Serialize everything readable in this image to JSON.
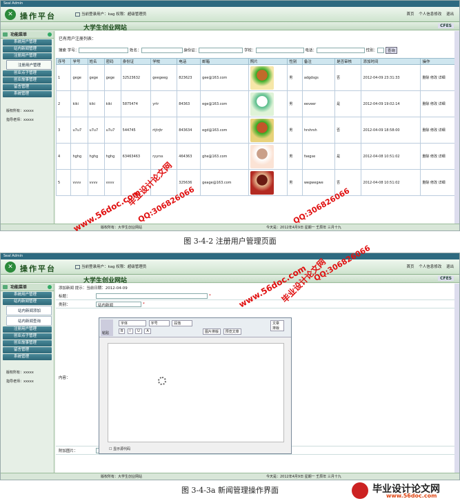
{
  "s1": {
    "window_title": "Seal Admin",
    "brand": "操作平台",
    "user_bar": "当前登录用户：kag 权限：超级管理员",
    "links": [
      "首页",
      "个人信息修改",
      "退出"
    ],
    "site_title": "大学生创业网站",
    "cfes": "CFES",
    "menu_header": "功能菜单",
    "menu": [
      "系统用户管理",
      "站内新闻管理",
      "注册用户管理",
      "注册用户管理",
      "创业点子管理",
      "创业故事管理",
      "留言管理",
      "系统管理"
    ],
    "info1": "版权所有：xxxxx",
    "info2": "指导老师：xxxxx",
    "list_title": "已有用户注册列表：",
    "search": {
      "label": "搜索",
      "fields": [
        "学号：",
        "姓名：",
        "身份证：",
        "学校：",
        "电话：",
        "性别："
      ],
      "button": "查询"
    },
    "columns": [
      "序号",
      "学号",
      "姓名",
      "密码",
      "身份证",
      "学校",
      "电话",
      "邮箱",
      "照片",
      "性别",
      "备注",
      "是否审核",
      "添加时间",
      "操作"
    ],
    "rows": [
      [
        "1",
        "gege",
        "gege",
        "gege",
        "32523632",
        "geegeeg",
        "823623",
        "gee@163.com",
        "",
        "男",
        "adgdsgs",
        "否",
        "2012-04-09 23:31:33",
        "删除 修改 详细"
      ],
      [
        "2",
        "kiki",
        "kiki",
        "kiki",
        "5875474",
        "yrtr",
        "84363",
        "ege@163.com",
        "",
        "男",
        "eeveer",
        "是",
        "2012-04-09 19:02:14",
        "删除 修改 详细"
      ],
      [
        "3",
        "u7u7",
        "u7u7",
        "u7u7",
        "544745",
        "rtjtrjtr",
        "843634",
        "egd@163.com",
        "",
        "男",
        "hrshrsh",
        "否",
        "2012-04-09 18:58:00",
        "删除 修改 详细"
      ],
      [
        "4",
        "hghg",
        "hghg",
        "hghg",
        "63463463",
        "ryyrss",
        "464363",
        "ghe@163.com",
        "",
        "男",
        "fsegse",
        "是",
        "2012-04-08 10:51:02",
        "删除 修改 详细"
      ],
      [
        "5",
        "vvvv",
        "vvvv",
        "vvvv",
        "",
        "",
        "325636",
        "geage@163.com",
        "",
        "男",
        "wegwegwe",
        "否",
        "2012-04-08 10:51:02",
        "删除 修改 详细"
      ]
    ],
    "status_left": "版权所有：大学生创业网站",
    "status_right": "今天是：2012年4月9日 星期一 壬辰年 三月十九"
  },
  "caption1": "图 3-4-2 注册用户管理页面",
  "s2": {
    "window_title": "Seal Admin",
    "brand": "操作平台",
    "user_bar": "当前登录用户：kag 权限：超级管理员",
    "links": [
      "首页",
      "个人信息修改",
      "退出"
    ],
    "site_title": "大学生创业网站",
    "cfes": "CFES",
    "menu_header": "功能菜单",
    "menu": [
      "系统用户管理",
      "站内新闻管理",
      "站内新闻添加",
      "站内新闻查询",
      "注册用户管理",
      "创业点子管理",
      "创业故事管理",
      "留言管理",
      "系统管理"
    ],
    "info1": "版权所有：xxxxx",
    "info2": "指导老师：xxxxx",
    "top_line": "添加新闻 提示：当前日期：2012-04-09",
    "label_title": "标题：",
    "label_cat": "类别：",
    "cat_value": "站内新闻",
    "label_content": "内容：",
    "label_extra": "附加图片：",
    "editor_row1": [
      "字体",
      "字号",
      "段落"
    ],
    "editor_row2": [
      "B",
      "I",
      "U",
      "A"
    ],
    "editor_btns": [
      "图片排版",
      "预览文章",
      "文章排版"
    ],
    "paste": "粘贴",
    "show_source": "显示源代码",
    "status_left": "版权所有：大学生创业网站",
    "status_right": "今天是：2012年4月9日 星期一 壬辰年 三月十九"
  },
  "caption2": "图 3-4-3a 新闻管理操作界面",
  "watermarks": [
    "毕业设计论文网",
    "www.56doc.com",
    "QQ:306826066"
  ],
  "footer_brand": "毕业设计论文网",
  "footer_site": "www.56doc.com"
}
